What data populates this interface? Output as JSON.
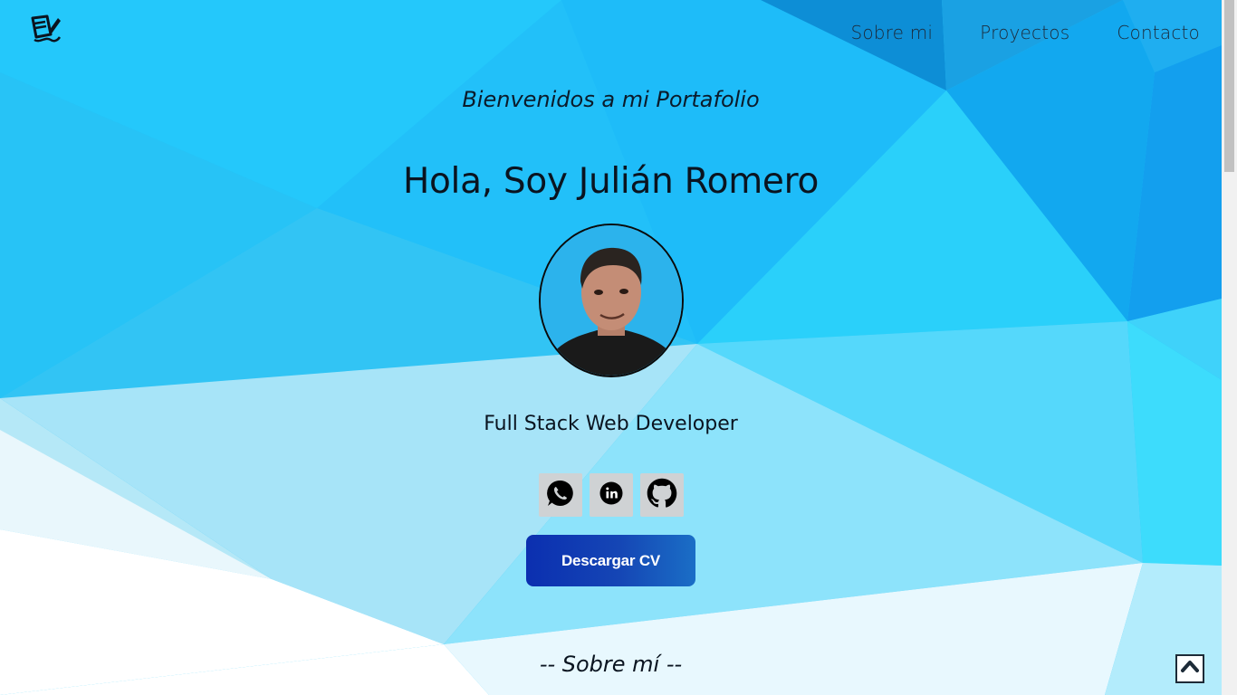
{
  "nav": {
    "logo_icon": "pen-and-paper-icon",
    "links": [
      {
        "label": "Sobre mi"
      },
      {
        "label": "Proyectos"
      },
      {
        "label": "Contacto"
      }
    ]
  },
  "hero": {
    "welcome": "Bienvenidos a mi Portafolio",
    "name": "Hola, Soy Julián Romero",
    "role": "Full Stack Web Developer",
    "socials": [
      {
        "icon": "whatsapp-icon"
      },
      {
        "icon": "linkedin-icon"
      },
      {
        "icon": "github-icon"
      }
    ],
    "cv_button": "Descargar CV"
  },
  "section": {
    "title": "-- Sobre mí --"
  },
  "colors": {
    "accent": "#0b2fb0",
    "background": "#1ec8f8"
  }
}
